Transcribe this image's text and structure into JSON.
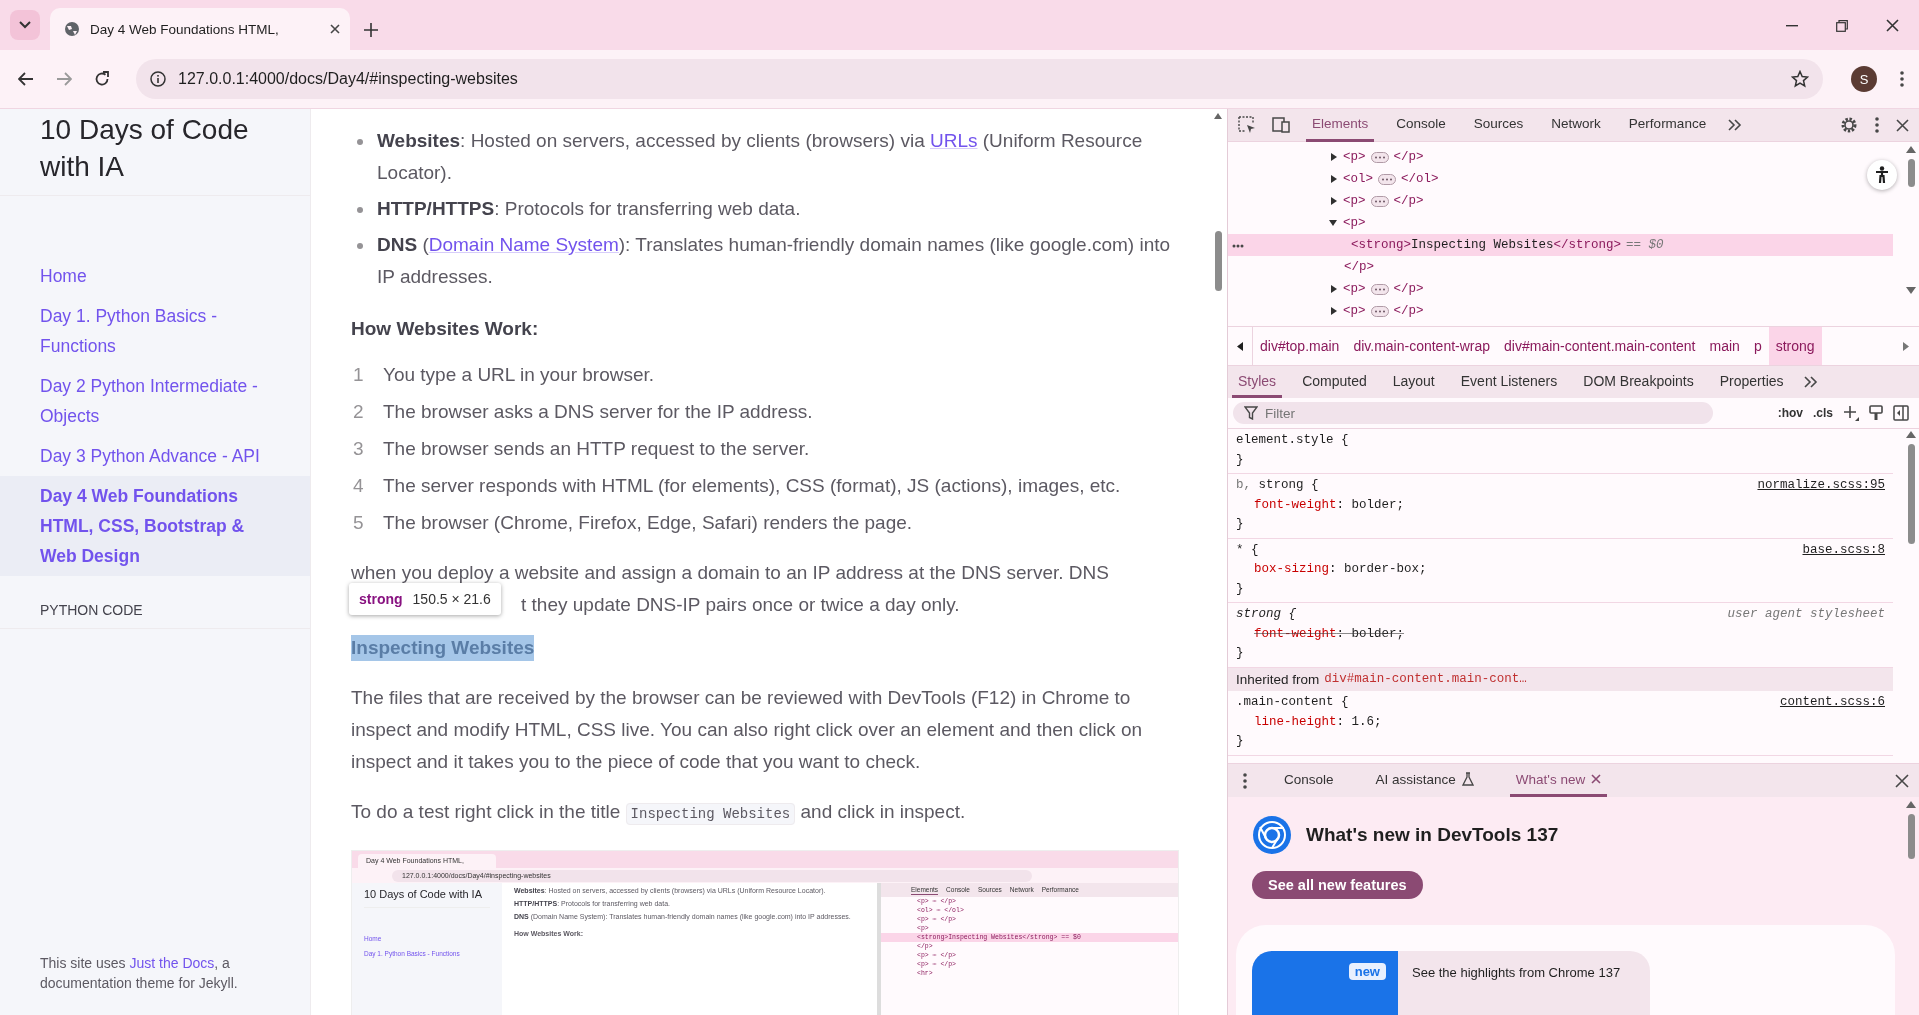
{
  "browser": {
    "tab_title": "Day 4 Web Foundations HTML,",
    "url": "127.0.0.1:4000/docs/Day4/#inspecting-websites",
    "profile_initial": "S"
  },
  "sidebar": {
    "site_title": "10 Days of Code with IA",
    "nav": [
      {
        "label": "Home",
        "selected": false
      },
      {
        "label": "Day 1. Python Basics - Functions",
        "selected": false
      },
      {
        "label": "Day 2 Python Intermediate - Objects",
        "selected": false
      },
      {
        "label": "Day 3 Python Advance - API",
        "selected": false
      },
      {
        "label": "Day 4 Web Foundations HTML, CSS, Bootstrap & Web Design",
        "selected": true
      }
    ],
    "section_label": "PYTHON CODE",
    "footer": [
      {
        "kind": "text",
        "text": "This site uses "
      },
      {
        "kind": "link",
        "text": "Just the Docs"
      },
      {
        "kind": "text",
        "text": ", a documentation theme for Jekyll."
      }
    ]
  },
  "content": {
    "bullets": [
      [
        {
          "kind": "bold",
          "text": "Websites"
        },
        {
          "kind": "text",
          "text": ": Hosted on servers, accessed by clients (browsers) via "
        },
        {
          "kind": "link",
          "text": "URLs"
        },
        {
          "kind": "text",
          "text": " (Uniform Resource Locator)."
        }
      ],
      [
        {
          "kind": "bold",
          "text": "HTTP/HTTPS"
        },
        {
          "kind": "text",
          "text": ": Protocols for transferring web data."
        }
      ],
      [
        {
          "kind": "bold",
          "text": "DNS"
        },
        {
          "kind": "text",
          "text": " ("
        },
        {
          "kind": "link",
          "text": "Domain Name System"
        },
        {
          "kind": "text",
          "text": "): Translates human-friendly domain names (like google.com) into IP addresses."
        }
      ]
    ],
    "steps_heading": "How Websites Work:",
    "steps": [
      {
        "number": "1",
        "text": "You type a URL in your browser."
      },
      {
        "number": "2",
        "text": "The browser asks a DNS server for the IP address."
      },
      {
        "number": "3",
        "text": "The browser sends an HTTP request to the server."
      },
      {
        "number": "4",
        "text": "The server responds with HTML (for elements), CSS (format), JS (actions), images, etc."
      },
      {
        "number": "5",
        "text": "The browser (Chrome, Firefox, Edge, Safari) renders the page."
      }
    ],
    "note_lines": [
      "when you deploy a website and assign a domain to an IP address at the DNS server. DNS",
      "t they update DNS-IP pairs once or twice a day only."
    ],
    "tooltip": {
      "tag": "strong",
      "size": "150.5 × 21.6"
    },
    "inspected_heading": "Inspecting Websites",
    "paragraph": "The files that are received by the browser can be reviewed with DevTools (F12) in Chrome to inspect and modify HTML, CSS live. You can also right click over an element and then click on inspect and it takes you to the piece of code that you want to check.",
    "test_line": [
      {
        "kind": "text",
        "text": "To do a test right click in the title "
      },
      {
        "kind": "code",
        "text": "Inspecting Websites"
      },
      {
        "kind": "text",
        "text": " and click in inspect."
      }
    ]
  },
  "screenshot": {
    "tab_title": "Day 4 Web Foundations HTML,",
    "url": "127.0.0.1:4000/docs/Day4/#inspecting-websites",
    "site_title": "10 Days of Code with IA",
    "nav": [
      "Home",
      "Day 1. Python Basics - Functions"
    ],
    "bullets": [
      "**Websites**: Hosted on servers, accessed by clients (browsers) via URLs (Uniform Resource Locator).",
      "**HTTP/HTTPS**: Protocols for transferring web data.",
      "**DNS** (Domain Name System): Translates human-friendly domain names (like google.com) into IP addresses."
    ],
    "heading": "How Websites Work:",
    "devtools_tabs": [
      {
        "label": "Elements",
        "selected": true
      },
      {
        "label": "Console",
        "selected": false
      },
      {
        "label": "Sources",
        "selected": false
      },
      {
        "label": "Network",
        "selected": false
      },
      {
        "label": "Performance",
        "selected": false
      }
    ],
    "dom_lines": [
      {
        "text": "<p> ⋯ </p>",
        "selected": false
      },
      {
        "text": "<ol> ⋯ </ol>",
        "selected": false
      },
      {
        "text": "<p> ⋯ </p>",
        "selected": false
      },
      {
        "text": "<p>",
        "selected": false
      },
      {
        "text": "<strong>Inspecting Websites</strong> == $0",
        "selected": true
      },
      {
        "text": "</p>",
        "selected": false
      },
      {
        "text": "<p> ⋯ </p>",
        "selected": false
      },
      {
        "text": "<p> ⋯ </p>",
        "selected": false
      },
      {
        "text": "<hr>",
        "selected": false
      }
    ]
  },
  "devtools": {
    "tabs": [
      {
        "label": "Elements",
        "selected": true
      },
      {
        "label": "Console",
        "selected": false
      },
      {
        "label": "Sources",
        "selected": false
      },
      {
        "label": "Network",
        "selected": false
      },
      {
        "label": "Performance",
        "selected": false
      }
    ],
    "dom": [
      {
        "kind": "collapsed",
        "open": "<p>",
        "close": "</p>"
      },
      {
        "kind": "collapsed",
        "open": "<ol>",
        "close": "</ol>"
      },
      {
        "kind": "collapsed",
        "open": "<p>",
        "close": "</p>"
      },
      {
        "kind": "expanded",
        "open": "<p>"
      },
      {
        "kind": "selected",
        "open": "<strong>",
        "inner": "Inspecting Websites",
        "close": "</strong>",
        "suffix": "== $0"
      },
      {
        "kind": "closing",
        "close": "</p>"
      },
      {
        "kind": "collapsed",
        "open": "<p>",
        "close": "</p>"
      },
      {
        "kind": "collapsed",
        "open": "<p>",
        "close": "</p>"
      }
    ],
    "breadcrumbs": [
      {
        "label": "div#top.main",
        "selected": false
      },
      {
        "label": "div.main-content-wrap",
        "selected": false
      },
      {
        "label": "div#main-content.main-content",
        "selected": false
      },
      {
        "label": "main",
        "selected": false
      },
      {
        "label": "p",
        "selected": false
      },
      {
        "label": "strong",
        "selected": true
      }
    ],
    "style_tabs": [
      {
        "label": "Styles",
        "selected": true
      },
      {
        "label": "Computed",
        "selected": false
      },
      {
        "label": "Layout",
        "selected": false
      },
      {
        "label": "Event Listeners",
        "selected": false
      },
      {
        "label": "DOM Breakpoints",
        "selected": false
      },
      {
        "label": "Properties",
        "selected": false
      }
    ],
    "filter": {
      "placeholder": "Filter"
    },
    "toggles": [
      ":hov",
      ".cls"
    ],
    "rules": [
      {
        "kind": "inline",
        "selector": "element.style {",
        "close": "}"
      },
      {
        "kind": "author",
        "selector_dim": "b, ",
        "selector": "strong {",
        "source": "normalize.scss:95",
        "close": "}",
        "props": [
          {
            "name": "font-weight",
            "rest": ": bolder;",
            "overridden": false
          }
        ]
      },
      {
        "kind": "author",
        "selector": "* {",
        "source": "base.scss:8",
        "close": "}",
        "props": [
          {
            "name": "box-sizing",
            "rest": ": border-box;",
            "overridden": false
          }
        ]
      },
      {
        "kind": "user_agent",
        "selector": "strong {",
        "source": "user agent stylesheet",
        "close": "}",
        "props": [
          {
            "name": "font-weight",
            "rest": ": bolder;",
            "overridden": true
          }
        ]
      },
      {
        "kind": "inherited",
        "label": "Inherited from",
        "selector": "div#main-content.main-cont…"
      },
      {
        "kind": "author",
        "selector": ".main-content {",
        "source": "content.scss:6",
        "close": "}",
        "props": [
          {
            "name": "line-height",
            "rest": ": 1.6;",
            "overridden": false
          }
        ]
      }
    ],
    "drawer": {
      "tabs": [
        {
          "label": "Console",
          "selected": false,
          "kind": "plain"
        },
        {
          "label": "AI assistance",
          "selected": false,
          "kind": "experimental"
        },
        {
          "label": "What's new",
          "selected": true,
          "kind": "closable"
        }
      ],
      "title": "What's new in DevTools 137",
      "button": "See all new features",
      "card": {
        "badge": "new",
        "text": "See the highlights from Chrome 137"
      }
    }
  }
}
